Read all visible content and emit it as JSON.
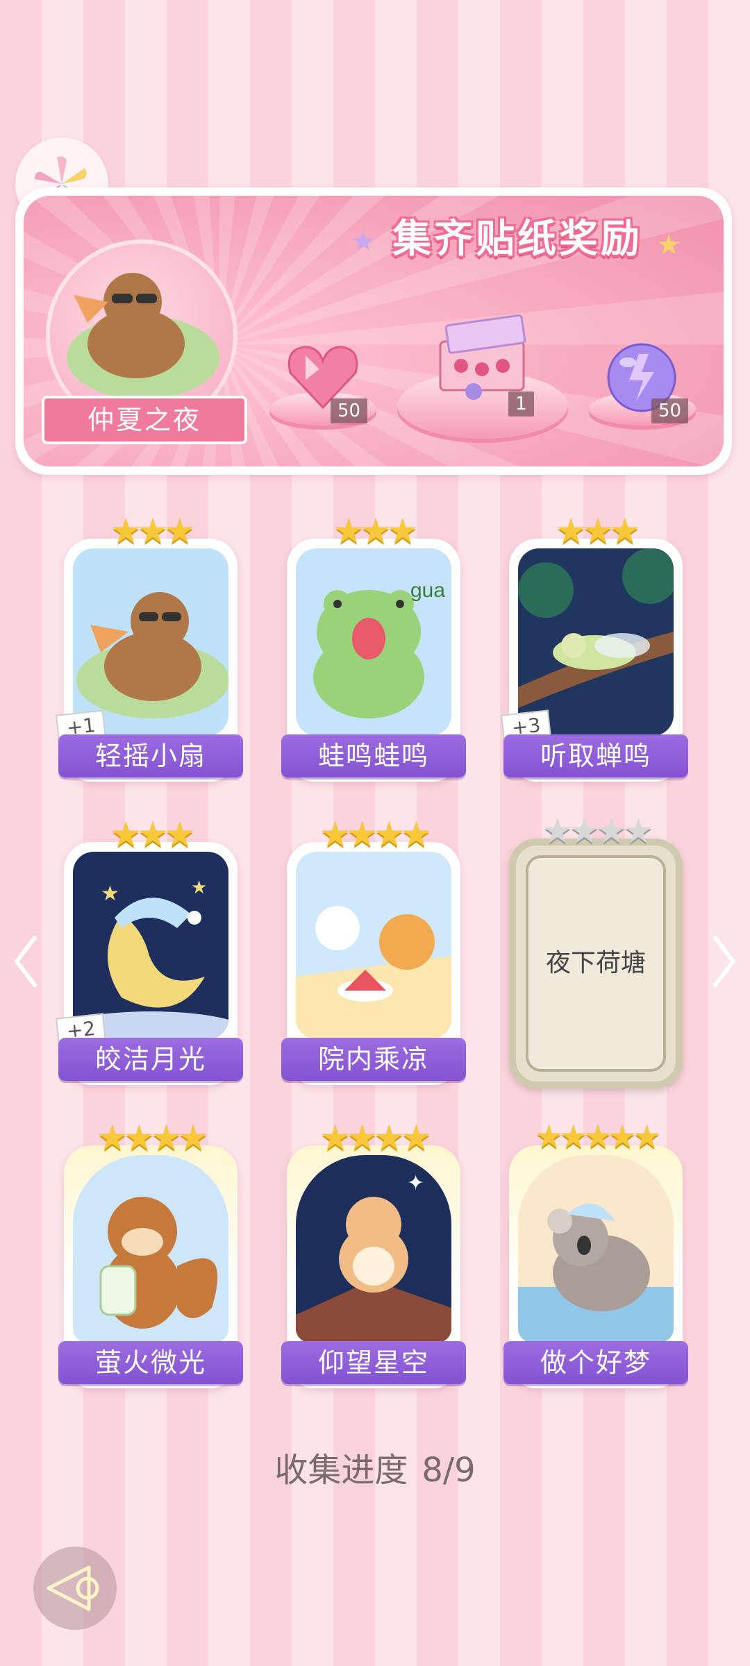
{
  "banner": {
    "title": "集齐贴纸奖励",
    "hero_name": "仲夏之夜",
    "rewards": [
      {
        "icon": "pink-heart-gem-icon",
        "count": "50"
      },
      {
        "icon": "gift-box-icon",
        "count": "1"
      },
      {
        "icon": "purple-energy-orb-icon",
        "count": "50"
      }
    ]
  },
  "cards": [
    {
      "name": "轻摇小扇",
      "stars": 3,
      "badge": "+1",
      "collected": true
    },
    {
      "name": "蛙鸣蛙鸣",
      "stars": 3,
      "badge": "",
      "collected": true
    },
    {
      "name": "听取蝉鸣",
      "stars": 3,
      "badge": "+3",
      "collected": true
    },
    {
      "name": "皎洁月光",
      "stars": 3,
      "badge": "+2",
      "collected": true
    },
    {
      "name": "院内乘凉",
      "stars": 4,
      "badge": "",
      "collected": true
    },
    {
      "name": "夜下荷塘",
      "stars": 4,
      "badge": "",
      "collected": false
    },
    {
      "name": "萤火微光",
      "stars": 4,
      "badge": "",
      "collected": true
    },
    {
      "name": "仰望星空",
      "stars": 4,
      "badge": "",
      "collected": true
    },
    {
      "name": "做个好梦",
      "stars": 5,
      "badge": "",
      "collected": true
    }
  ],
  "progress": {
    "label": "收集进度",
    "value": "8/9"
  },
  "colors": {
    "accent_purple": "#8452d3",
    "banner_pink": "#f08fae",
    "star_gold": "#f6c83a"
  }
}
